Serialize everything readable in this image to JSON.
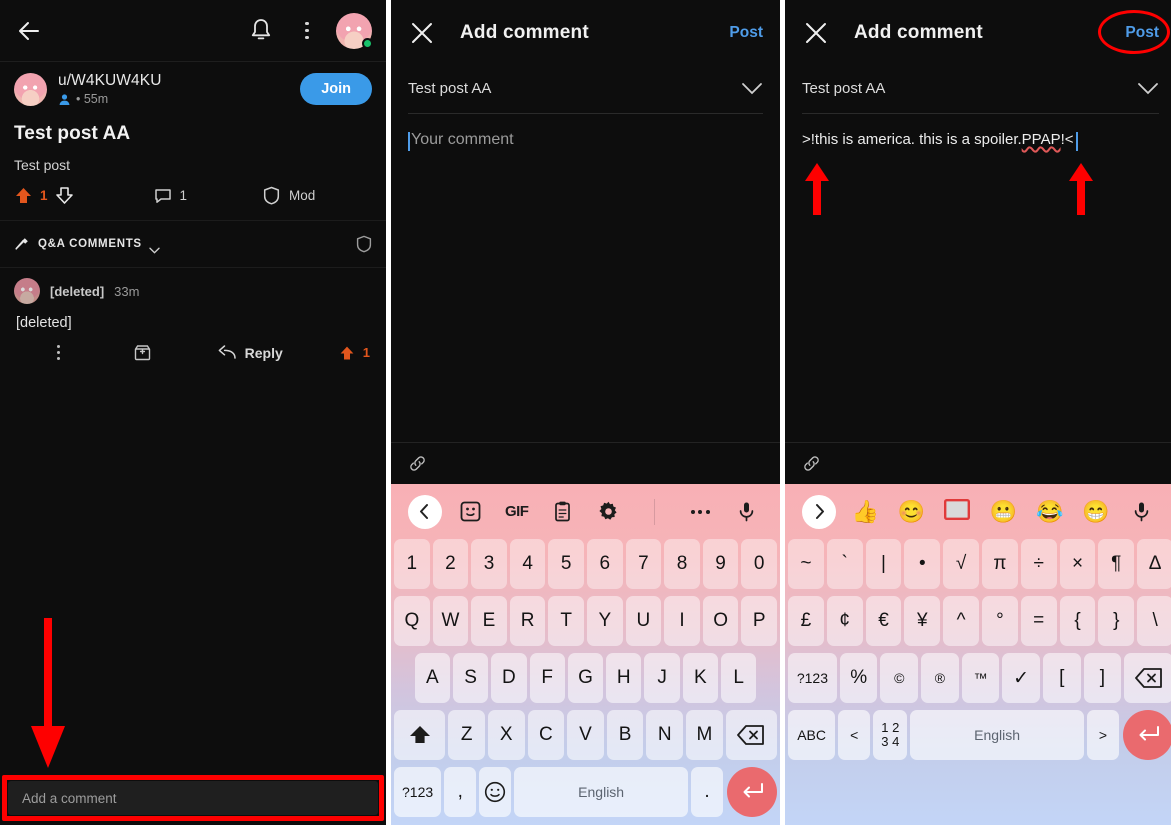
{
  "panel1": {
    "topbar": {
      "back": "back-arrow",
      "bell": "notifications",
      "menu": "more-options"
    },
    "post": {
      "username": "u/W4KUW4KU",
      "meta_time": "• 55m",
      "join_label": "Join",
      "title": "Test post AA",
      "body": "Test post",
      "upvote_count": "1",
      "comment_count": "1",
      "mod_label": "Mod"
    },
    "sort_bar": {
      "label": "Q&A COMMENTS"
    },
    "comment": {
      "author": "[deleted]",
      "time": "33m",
      "body": "[deleted]",
      "reply_label": "Reply",
      "vote_count": "1"
    },
    "add_comment_placeholder": "Add a comment"
  },
  "panel2": {
    "header": {
      "title": "Add comment",
      "post_label": "Post"
    },
    "subject": "Test post AA",
    "input_placeholder": "Your comment",
    "keyboard": {
      "toolbar": [
        "chevron-left",
        "sticker",
        "GIF",
        "clipboard",
        "settings",
        "more",
        "mic"
      ],
      "gif_label": "GIF",
      "row1": [
        "1",
        "2",
        "3",
        "4",
        "5",
        "6",
        "7",
        "8",
        "9",
        "0"
      ],
      "row2": [
        "Q",
        "W",
        "E",
        "R",
        "T",
        "Y",
        "U",
        "I",
        "O",
        "P"
      ],
      "row3": [
        "A",
        "S",
        "D",
        "F",
        "G",
        "H",
        "J",
        "K",
        "L"
      ],
      "row4": [
        "Z",
        "X",
        "C",
        "V",
        "B",
        "N",
        "M"
      ],
      "shift": "shift",
      "backspace": "backspace",
      "symbols_key": "?123",
      "comma": ",",
      "emoji_key": "emoji",
      "space_label": "English",
      "period": ".",
      "enter": "enter"
    }
  },
  "panel3": {
    "header": {
      "title": "Add comment",
      "post_label": "Post"
    },
    "subject": "Test post AA",
    "comment_prefix": ">!this is america. this is a spoiler. ",
    "comment_spellcheck_word": "PPAP",
    "comment_suffix": "!<",
    "keyboard": {
      "toolbar_emoji": [
        "chevron-right",
        "👍",
        "😊",
        "recent-box",
        "😬",
        "😂",
        "😁",
        "mic"
      ],
      "row1": [
        "~",
        "`",
        "|",
        "•",
        "√",
        "π",
        "÷",
        "×",
        "¶",
        "Δ"
      ],
      "row2": [
        "£",
        "¢",
        "€",
        "¥",
        "^",
        "°",
        "=",
        "{",
        "}",
        "\\"
      ],
      "row3_first": "?123",
      "row3": [
        "%",
        "©",
        "®",
        "™",
        "✓",
        "[",
        "]"
      ],
      "backspace": "backspace",
      "abc_key": "ABC",
      "lt_key": "<",
      "num_key": "1234",
      "space_label": "English",
      "gt_key": ">",
      "enter": "enter"
    }
  },
  "annotations": {
    "accent_red": "#fe0000",
    "post_highlight": "ellipse-around-post-button",
    "arrow_down_add_comment": "arrow-pointing-to-add-comment",
    "arrow_up_spoiler_start": "arrow-pointing-to-spoiler-open",
    "arrow_up_spoiler_end": "arrow-pointing-to-spoiler-close"
  }
}
